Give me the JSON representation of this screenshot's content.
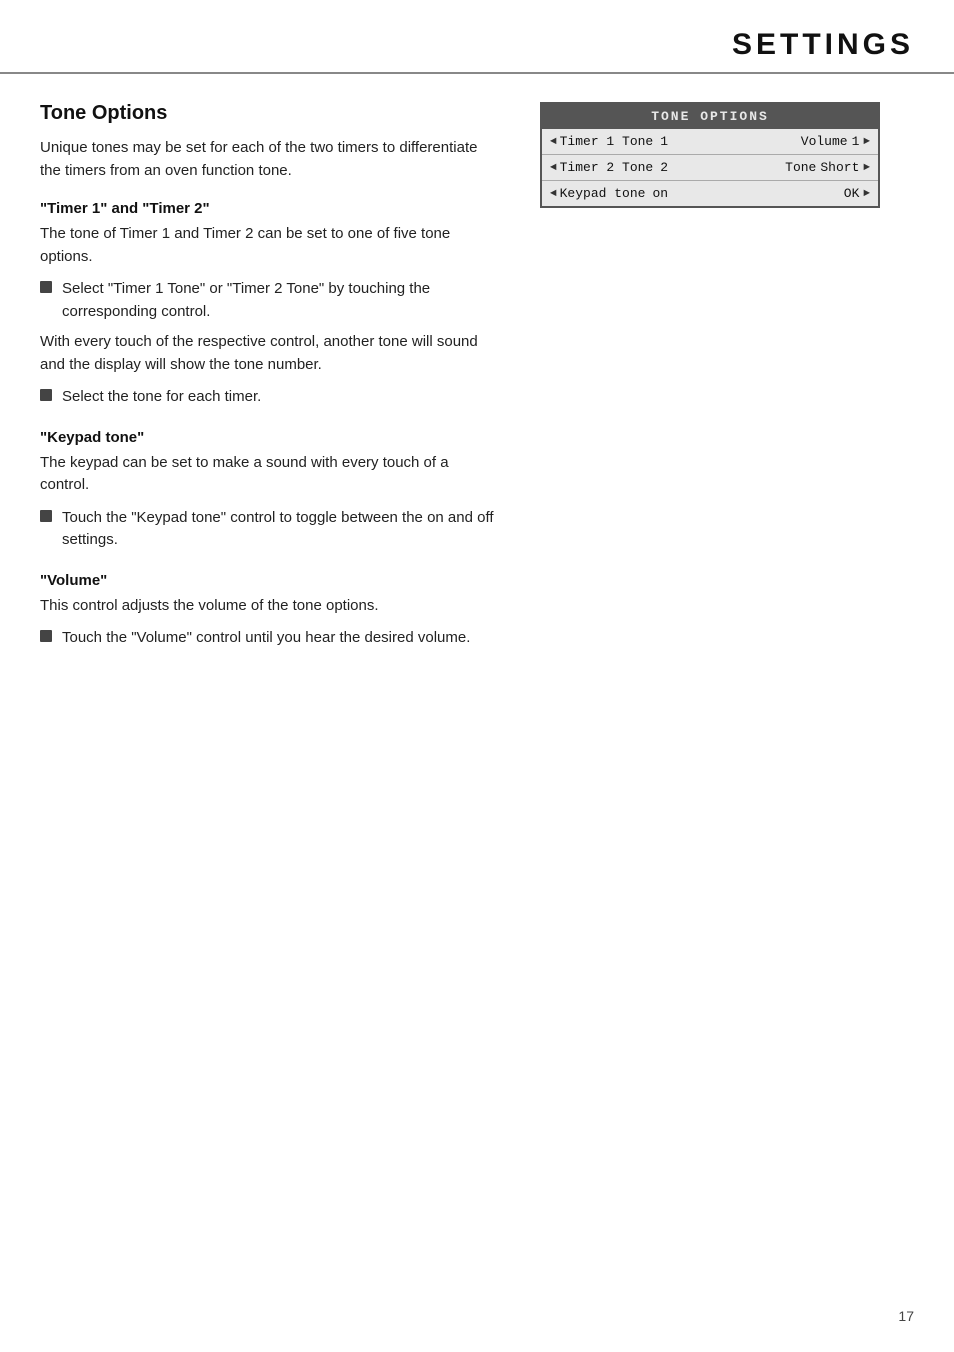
{
  "header": {
    "title": "SETTINGS"
  },
  "main": {
    "section_title": "Tone Options",
    "intro": "Unique tones may be set for each of the two timers to differentiate the timers from an oven function tone.",
    "subsections": [
      {
        "id": "timer-tones",
        "title": "\"Timer 1\" and \"Timer 2\"",
        "body": "The tone of Timer 1 and Timer 2 can be set to one of five tone options.",
        "bullets": [
          {
            "text": "Select \"Timer 1 Tone\" or \"Timer 2 Tone\" by touching the corresponding control."
          }
        ],
        "extra_text": "With every touch of the respective control, another tone will sound and the display will show the tone number.",
        "extra_bullets": [
          {
            "text": "Select the tone for each timer."
          }
        ]
      },
      {
        "id": "keypad-tone",
        "title": "\"Keypad tone\"",
        "body": "The keypad can be set to make a sound with every touch of a control.",
        "bullets": [
          {
            "text": "Touch the \"Keypad tone\" control to toggle between the on and off settings."
          }
        ]
      },
      {
        "id": "volume",
        "title": "\"Volume\"",
        "body": "This control adjusts the volume of the tone options.",
        "bullets": [
          {
            "text": "Touch the \"Volume\" control until you hear the desired volume."
          }
        ]
      }
    ]
  },
  "panel": {
    "header": "TONE OPTIONS",
    "rows": [
      {
        "id": "timer1",
        "arrow_left": "◄",
        "label": "Timer 1 Tone",
        "value": "1",
        "sublabel": "Volume",
        "subvalue": "1",
        "arrow_right": "►"
      },
      {
        "id": "timer2",
        "arrow_left": "◄",
        "label": "Timer 2 Tone",
        "value": "2",
        "sublabel": "Tone",
        "subvalue": "Short",
        "arrow_right": "►"
      },
      {
        "id": "keypad",
        "arrow_left": "◄",
        "label": "Keypad tone",
        "value": "on",
        "sublabel": "",
        "subvalue": "OK",
        "arrow_right": "►"
      }
    ]
  },
  "page_number": "17"
}
